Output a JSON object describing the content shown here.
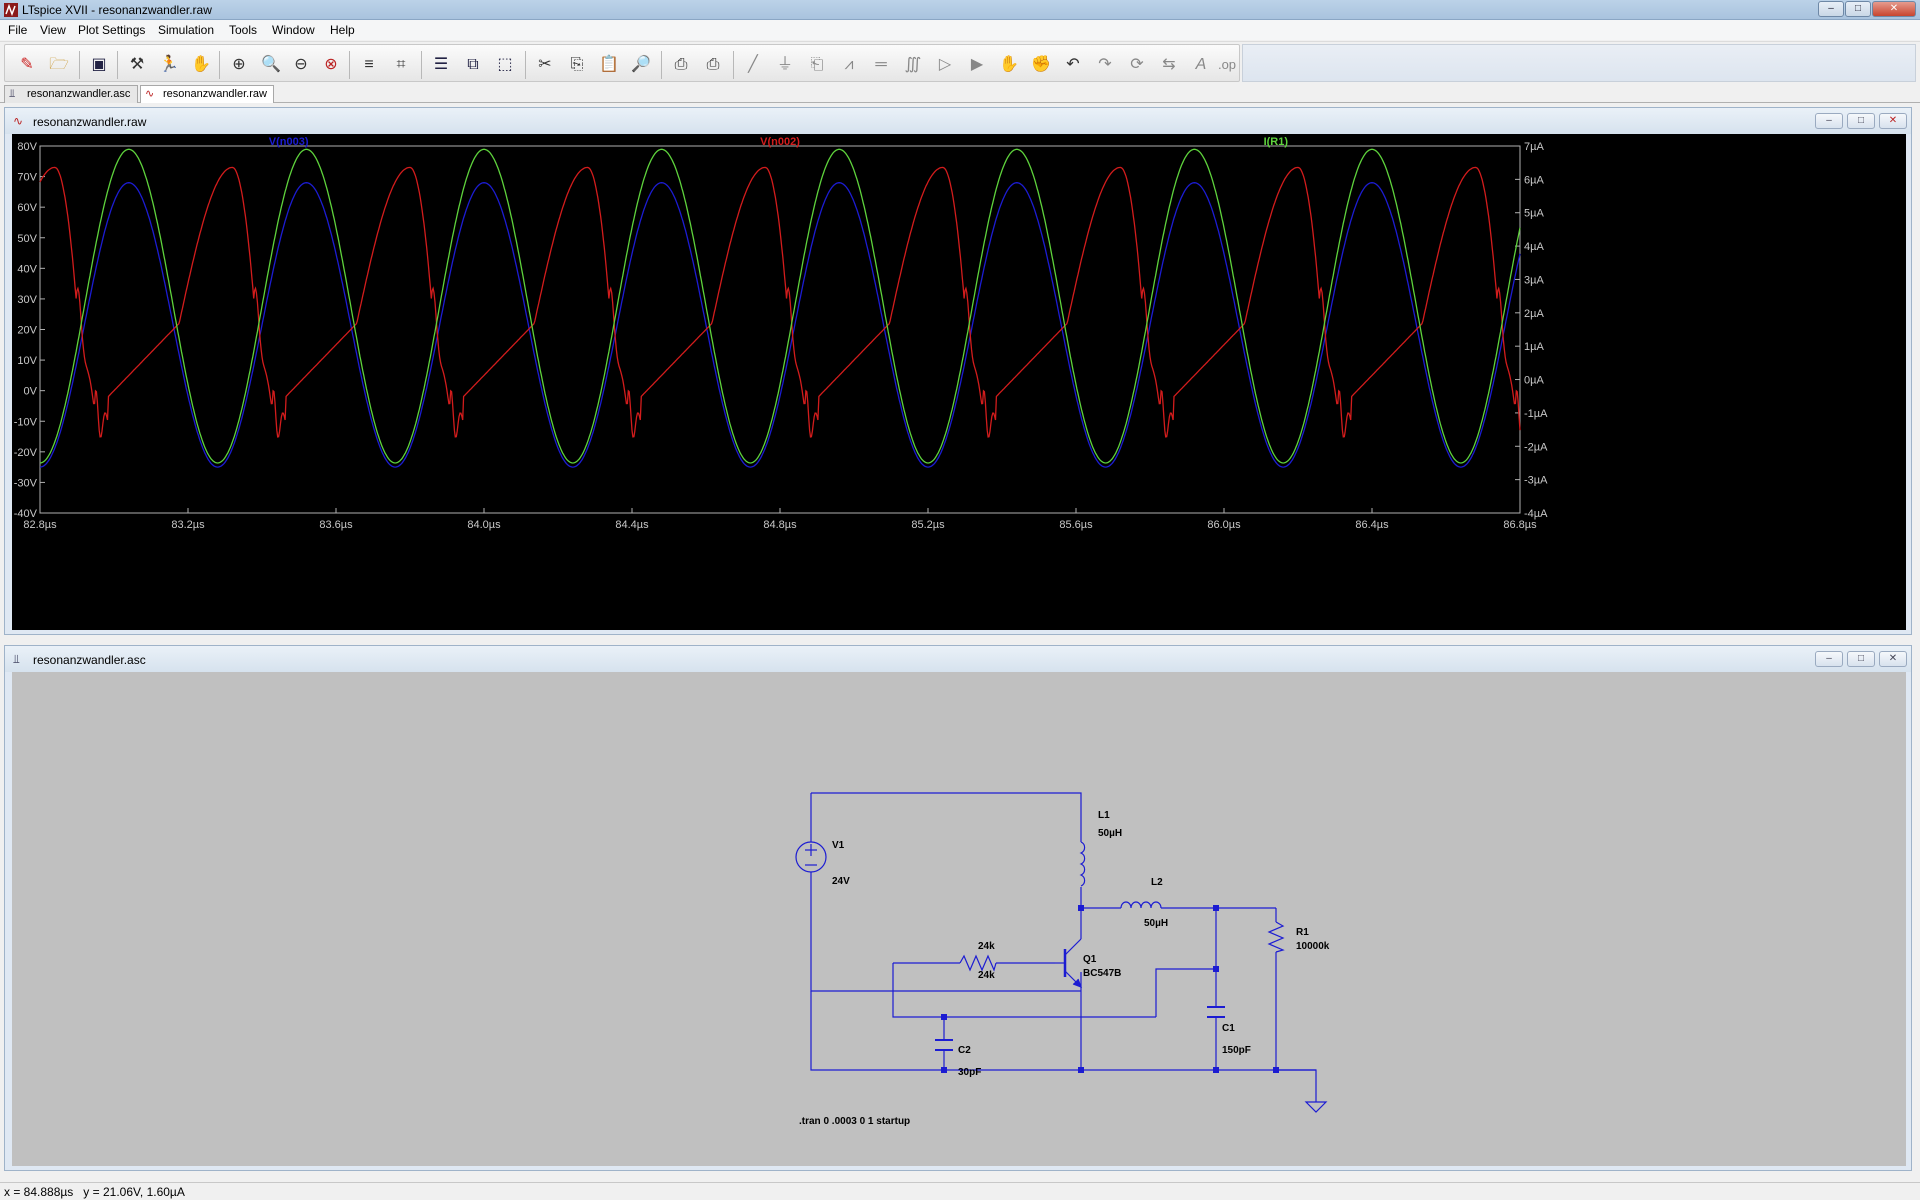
{
  "window": {
    "title": "LTspice XVII - resonanzwandler.raw",
    "minimize": "–",
    "maximize": "□",
    "close": "✕"
  },
  "menu": [
    "File",
    "View",
    "Plot Settings",
    "Simulation",
    "Tools",
    "Window",
    "Help"
  ],
  "toolbar_icons": [
    "new-schematic-icon",
    "open-icon",
    "save-icon",
    "control-panel-icon",
    "run-icon",
    "halt-icon",
    "zoom-in-icon",
    "zoom-full-icon",
    "zoom-out-icon",
    "zoom-cancel-icon",
    "autorange-icon",
    "grid-icon",
    "tile-horizontal-icon",
    "cascade-icon",
    "tile-vertical-icon",
    "cut-icon",
    "copy-icon",
    "paste-icon",
    "find-icon",
    "print-icon",
    "print-preview-icon",
    "wire-icon",
    "ground-icon",
    "label-icon",
    "resistor-icon",
    "capacitor-icon",
    "inductor-icon",
    "diode-icon",
    "component-icon",
    "move-icon",
    "drag-icon",
    "undo-icon",
    "redo-icon",
    "rotate-icon",
    "mirror-icon",
    "text-icon",
    "spice-directive-icon"
  ],
  "tabs": [
    {
      "label": "resonanzwandler.asc",
      "active": false,
      "icon": "schematic-icon"
    },
    {
      "label": "resonanzwandler.raw",
      "active": true,
      "icon": "waveform-icon"
    }
  ],
  "plot_window": {
    "title": "resonanzwandler.raw",
    "minimize": "–",
    "restore": "□",
    "close": "✕"
  },
  "schematic_window": {
    "title": "resonanzwandler.asc",
    "minimize": "–",
    "restore": "□",
    "close": "✕"
  },
  "chart_data": {
    "type": "line",
    "x_ticks": [
      "82.8µs",
      "83.2µs",
      "83.6µs",
      "84.0µs",
      "84.4µs",
      "84.8µs",
      "85.2µs",
      "85.6µs",
      "86.0µs",
      "86.4µs",
      "86.8µs"
    ],
    "xlim": [
      82.8,
      86.8
    ],
    "x_unit": "µs",
    "y_left_ticks": [
      "80V",
      "70V",
      "60V",
      "50V",
      "40V",
      "30V",
      "20V",
      "10V",
      "0V",
      "-10V",
      "-20V",
      "-30V",
      "-40V"
    ],
    "ylim_left": [
      -40,
      80
    ],
    "y_right_ticks": [
      "7µA",
      "6µA",
      "5µA",
      "4µA",
      "3µA",
      "2µA",
      "1µA",
      "0µA",
      "-1µA",
      "-2µA",
      "-3µA",
      "-4µA"
    ],
    "ylim_right": [
      -4,
      7
    ],
    "grid": false,
    "legend_placement": "top",
    "series": [
      {
        "name": "V(n003)",
        "color": "#1c1cd2",
        "axis": "left",
        "period_us": 0.48,
        "peak_us": 83.04,
        "min": -25,
        "max": 68
      },
      {
        "name": "V(n002)",
        "color": "#d21c1c",
        "axis": "left",
        "period_us": 0.48,
        "peak_us": 82.84,
        "min": -9,
        "max": 73
      },
      {
        "name": "I(R1)",
        "color": "#5ed23c",
        "axis": "right",
        "period_us": 0.48,
        "peak_us": 83.04,
        "min": -2.5,
        "max": 6.9
      }
    ]
  },
  "schematic": {
    "components": [
      {
        "ref": "V1",
        "value": "24V",
        "symbol": "voltage-source"
      },
      {
        "ref": "L1",
        "value": "50µH",
        "symbol": "inductor"
      },
      {
        "ref": "L2",
        "value": "50µH",
        "symbol": "inductor"
      },
      {
        "ref": "R1",
        "value": "10000k",
        "symbol": "resistor"
      },
      {
        "ref": "24k",
        "value": "24k",
        "symbol": "resistor"
      },
      {
        "ref": "Q1",
        "value": "BC547B",
        "symbol": "npn-transistor"
      },
      {
        "ref": "C1",
        "value": "150pF",
        "symbol": "capacitor"
      },
      {
        "ref": "C2",
        "value": "30pF",
        "symbol": "capacitor"
      }
    ],
    "directive": ".tran 0 .0003 0 1 startup"
  },
  "status": "x = 84.888µs   y = 21.06V, 1.60µA"
}
